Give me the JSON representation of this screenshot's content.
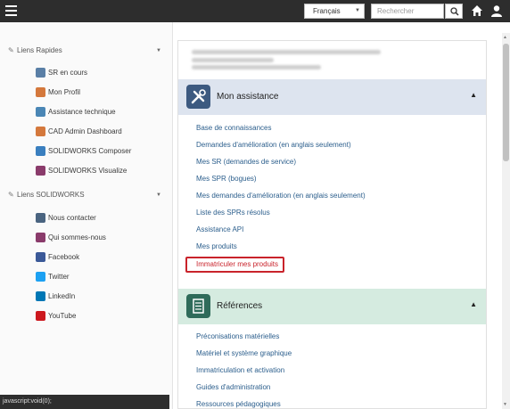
{
  "topbar": {
    "language": "Français",
    "search_placeholder": "Rechercher"
  },
  "sidebar": {
    "quick_links": {
      "title": "Liens Rapides",
      "items": [
        {
          "label": "SR en cours",
          "icon": "sr-icon",
          "color": "#5a7fa6"
        },
        {
          "label": "Mon Profil",
          "icon": "profile-icon",
          "color": "#d4783c"
        },
        {
          "label": "Assistance technique",
          "icon": "support-icon",
          "color": "#4a86b5"
        },
        {
          "label": "CAD Admin Dashboard",
          "icon": "dashboard-icon",
          "color": "#d4783c"
        },
        {
          "label": "SOLIDWORKS Composer",
          "icon": "composer-icon",
          "color": "#3a7fbf"
        },
        {
          "label": "SOLIDWORKS Visualize",
          "icon": "visualize-icon",
          "color": "#8a3b6b"
        }
      ]
    },
    "solidworks_links": {
      "title": "Liens SOLIDWORKS",
      "items": [
        {
          "label": "Nous contacter",
          "icon": "mail-icon",
          "color": "#4a6480"
        },
        {
          "label": "Qui sommes-nous",
          "icon": "about-icon",
          "color": "#8a3b6b"
        },
        {
          "label": "Facebook",
          "icon": "facebook-icon",
          "color": "#3b5998"
        },
        {
          "label": "Twitter",
          "icon": "twitter-icon",
          "color": "#1da1f2"
        },
        {
          "label": "LinkedIn",
          "icon": "linkedin-icon",
          "color": "#0077b5"
        },
        {
          "label": "YouTube",
          "icon": "youtube-icon",
          "color": "#cc181e"
        }
      ]
    }
  },
  "status_bar": "javascript:void(0);",
  "main": {
    "assistance": {
      "title": "Mon assistance",
      "header_color": "#dde4ef",
      "links": [
        "Base de connaissances",
        "Demandes d'amélioration (en anglais seulement)",
        "Mes SR (demandes de service)",
        "Mes SPR (bogues)",
        "Mes demandes d'amélioration (en anglais seulement)",
        "Liste des SPRs résolus",
        "Assistance API",
        "Mes produits",
        "Immatriculer mes produits"
      ]
    },
    "references": {
      "title": "Références",
      "header_color": "#d5ebe0",
      "links": [
        "Préconisations matérielles",
        "Matériel et système graphique",
        "Immatriculation et activation",
        "Guides d'administration",
        "Ressources pédagogiques"
      ]
    }
  },
  "colors": {
    "link": "#2b5e8c",
    "highlight": "#c9232b",
    "topbar": "#2d2d2d"
  }
}
